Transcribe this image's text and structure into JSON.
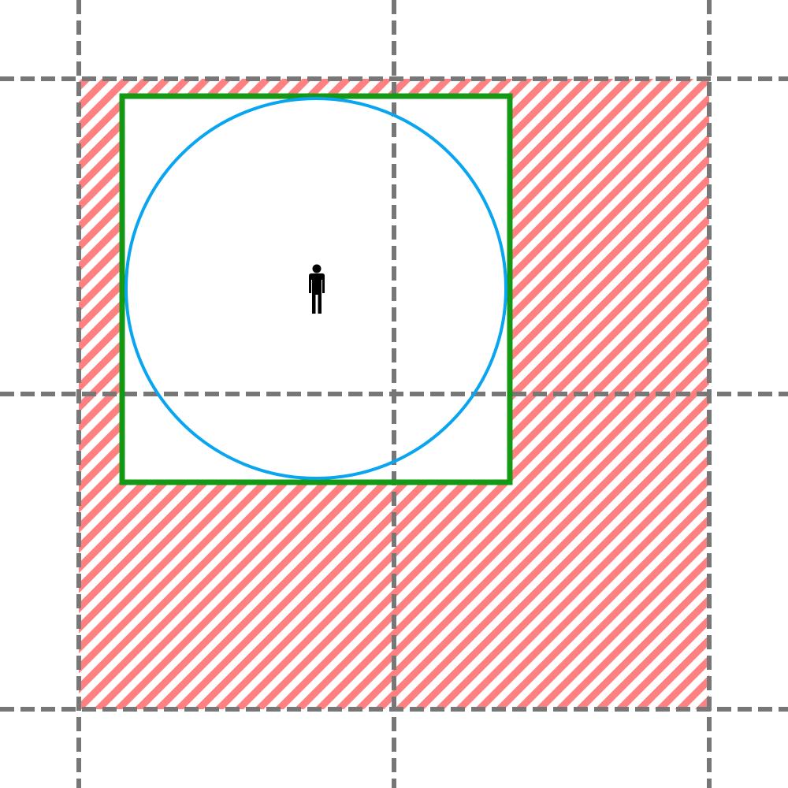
{
  "colors": {
    "background": "#ffffff",
    "grid_line": "#777777",
    "hatch": "#ff8080",
    "bounding_square": "#149914",
    "circle": "#0aa5f0",
    "person_icon": "#000000"
  },
  "icons": {
    "person": "person-icon"
  }
}
